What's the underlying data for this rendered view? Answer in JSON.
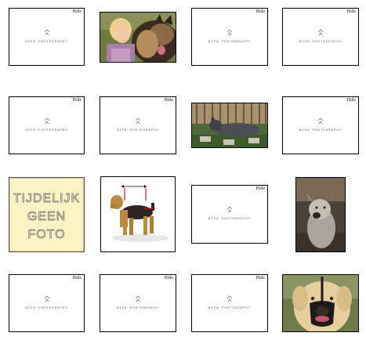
{
  "placeholder": {
    "hide_label": "Hide",
    "caption": "NIPA PHOTOGRAPHY"
  },
  "no_photo": {
    "line1": "TIJDELIJK",
    "line2": "GEEN",
    "line3": "FOTO"
  },
  "photos": {
    "child_with_dog": "child-with-dog",
    "dog_lying_garden": "dog-lying-in-garden",
    "airedale_measure": "airedale-measurement",
    "grey_dog": "grey-dog",
    "muzzled_dog": "muzzled-labrador"
  },
  "colors": {
    "border": "#000000",
    "placeholder_bg": "#ffffff",
    "nophoto_bg": "#fbf3c4"
  }
}
